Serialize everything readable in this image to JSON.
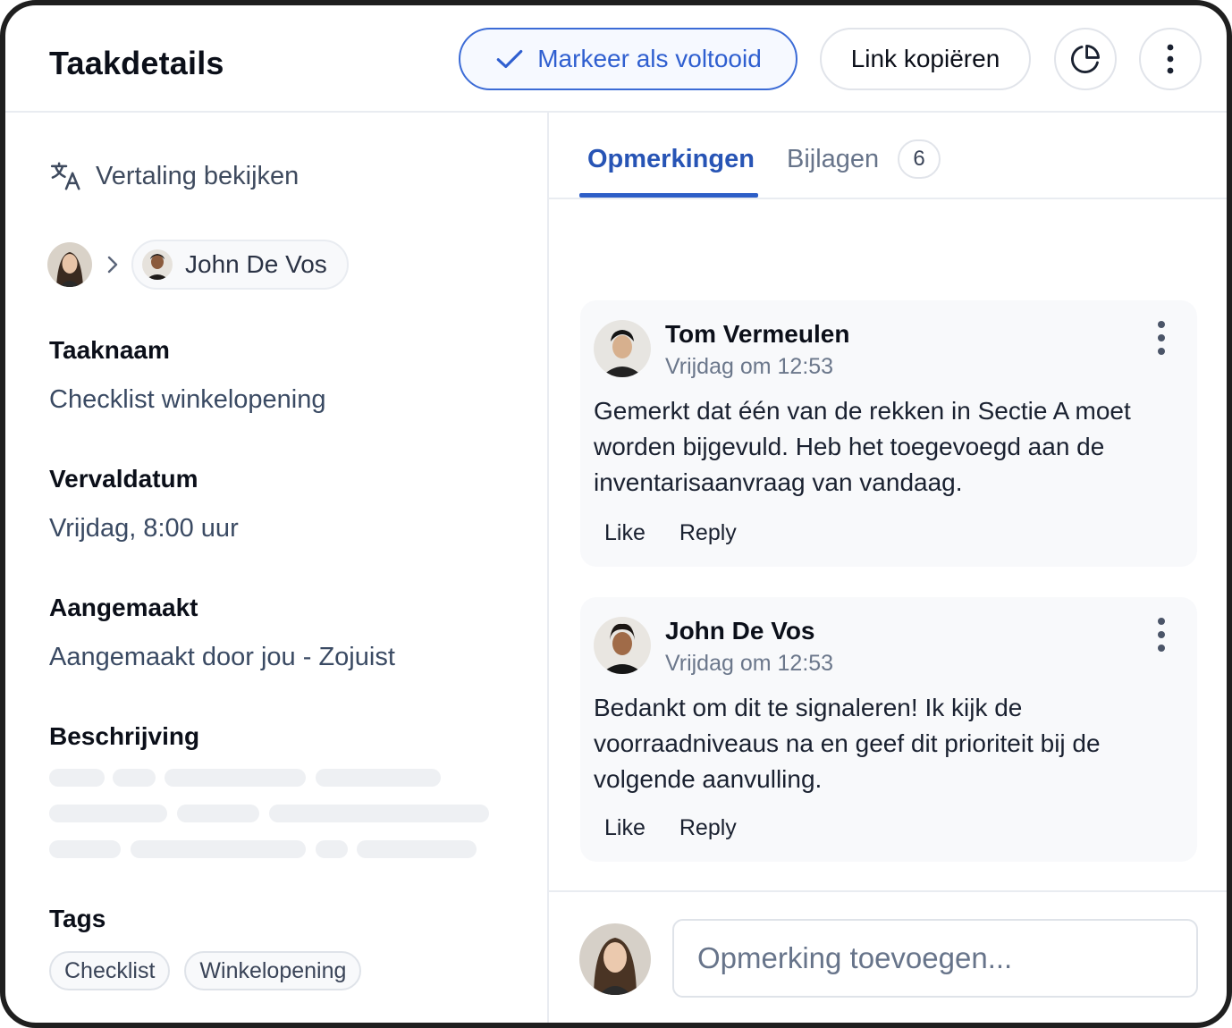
{
  "header": {
    "title": "Taakdetails",
    "mark_complete_label": "Markeer als voltooid",
    "copy_link_label": "Link kopiëren"
  },
  "colors": {
    "accent": "#2F5FD0",
    "border": "#E1E4EA",
    "muted_text": "#3A4A63",
    "skeleton": "#EEF0F3"
  },
  "left": {
    "translate_label": "Vertaling bekijken",
    "assignee_name": "John De Vos",
    "fields": {
      "task_name_label": "Taaknaam",
      "task_name_value": "Checklist winkelopening",
      "due_label": "Vervaldatum",
      "due_value": "Vrijdag, 8:00 uur",
      "created_label": "Aangemaakt",
      "created_value": "Aangemaakt door jou - Zojuist",
      "description_label": "Beschrijving",
      "tags_label": "Tags"
    },
    "tags": [
      "Checklist",
      "Winkelopening"
    ]
  },
  "right": {
    "tabs": [
      {
        "label": "Opmerkingen",
        "active": true
      },
      {
        "label": "Bijlagen",
        "count": "6",
        "active": false
      }
    ],
    "comments": [
      {
        "author": "Tom Vermeulen",
        "time": "Vrijdag om 12:53",
        "text": "Gemerkt dat één van de rekken in Sectie A moet worden bijgevuld. Heb het toegevoegd aan de inventarisaanvraag van vandaag.",
        "like_label": "Like",
        "reply_label": "Reply"
      },
      {
        "author": "John De Vos",
        "time": "Vrijdag om 12:53",
        "text": "Bedankt om dit te signaleren! Ik kijk de voorraadniveaus na en geef dit prioriteit bij de volgende aanvulling.",
        "like_label": "Like",
        "reply_label": "Reply"
      }
    ],
    "composer": {
      "placeholder": "Opmerking toevoegen...",
      "value": ""
    }
  }
}
